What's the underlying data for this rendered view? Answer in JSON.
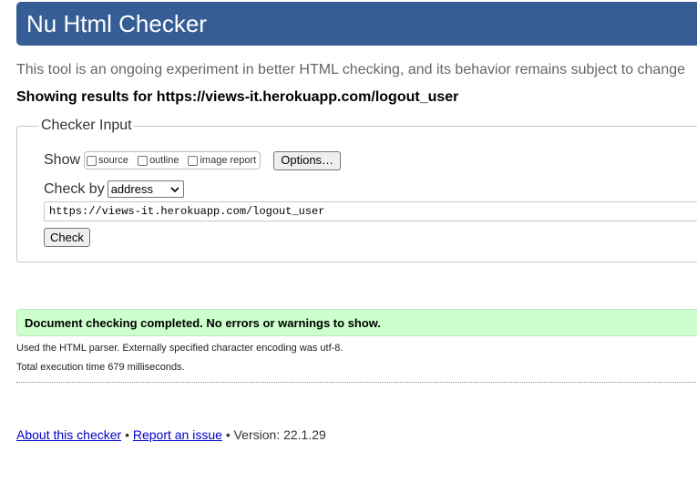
{
  "header": {
    "title": "Nu Html Checker",
    "color": "#365d95"
  },
  "tagline": "This tool is an ongoing experiment in better HTML checking, and its behavior remains subject to change",
  "showing": "Showing results for https://views-it.herokuapp.com/logout_user",
  "checker_input": {
    "legend": "Checker Input",
    "show_label": "Show",
    "options": [
      {
        "label": "source",
        "checked": false
      },
      {
        "label": "outline",
        "checked": false
      },
      {
        "label": "image report",
        "checked": false
      }
    ],
    "options_button": "Options…",
    "check_by_label": "Check by",
    "check_by_value": "address",
    "url_value": "https://views-it.herokuapp.com/logout_user",
    "check_button": "Check"
  },
  "result": {
    "message": "Document checking completed. No errors or warnings to show.",
    "color": "#ccffcc",
    "parser_info": "Used the HTML parser. Externally specified character encoding was utf-8.",
    "execution_time": "Total execution time 679 milliseconds."
  },
  "footer": {
    "about_link": "About this checker",
    "separator": "•",
    "report_link": "Report an issue",
    "version": "Version: 22.1.29"
  }
}
